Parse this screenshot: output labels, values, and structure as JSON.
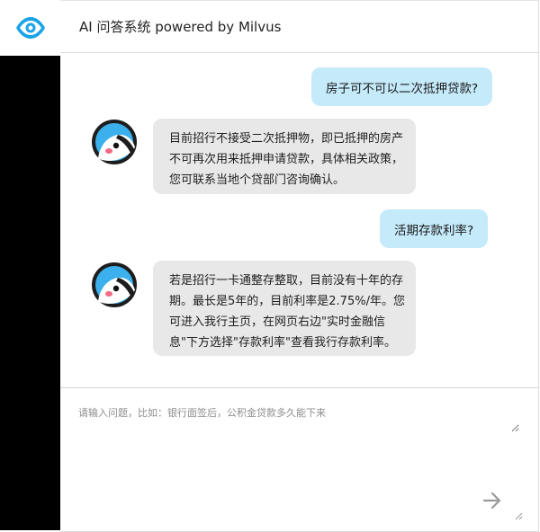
{
  "app": {
    "title": "AI 问答系统 powered by Milvus",
    "brand_color": "#1aa3e8"
  },
  "messages": [
    {
      "role": "user",
      "text": "房子可不可以二次抵押贷款?"
    },
    {
      "role": "bot",
      "lines": [
        "目前招行不接受二次抵押物，即已抵押的房产",
        "不可再次用来抵押申请贷款，具体相关政策，",
        "您可联系当地个贷部门咨询确认。"
      ]
    },
    {
      "role": "user",
      "text": "活期存款利率?"
    },
    {
      "role": "bot",
      "lines": [
        "若是招行一卡通整存整取，目前没有十年的存",
        "期。最长是5年的，目前利率是2.75%/年。您",
        "可进入我行主页，在网页右边\"实时金融信",
        "息\"下方选择\"存款利率\"查看我行存款利率。"
      ]
    }
  ],
  "input": {
    "placeholder": "请输入问题，比如：银行面签后，公积金贷款多久能下来",
    "value": ""
  },
  "icons": {
    "logo": "eye-logo-icon",
    "avatar": "bird-avatar-icon",
    "send": "arrow-right-icon",
    "resize": "resize-grip-icon"
  }
}
